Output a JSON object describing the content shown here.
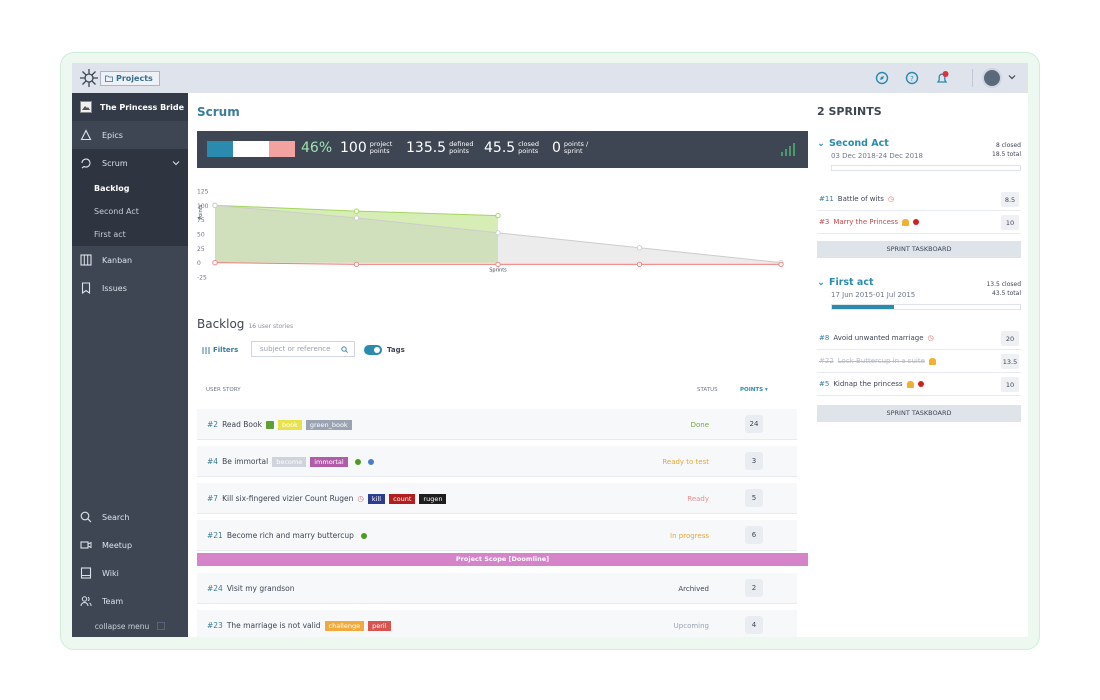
{
  "topbar": {
    "projects_label": "Projects"
  },
  "sidebar": {
    "project_name": "The Princess Bride",
    "items": [
      {
        "label": "Epics",
        "icon": "epics-icon"
      },
      {
        "label": "Scrum",
        "icon": "scrum-icon"
      },
      {
        "label": "Kanban",
        "icon": "kanban-icon"
      },
      {
        "label": "Issues",
        "icon": "issues-icon"
      }
    ],
    "scrum_sub": [
      "Backlog",
      "Second Act",
      "First act"
    ],
    "bottom": [
      {
        "label": "Search",
        "icon": "search-icon"
      },
      {
        "label": "Meetup",
        "icon": "meetup-icon"
      },
      {
        "label": "Wiki",
        "icon": "wiki-icon"
      },
      {
        "label": "Team",
        "icon": "team-icon"
      }
    ],
    "collapse_label": "collapse menu"
  },
  "main": {
    "title": "Scrum",
    "stats": {
      "percent": "46%",
      "closed_fraction": 0.3,
      "defined_fraction": 0.3,
      "project_points": "100",
      "project_points_label": "project points",
      "defined_points": "135.5",
      "defined_points_label": "defined points",
      "closed_points": "45.5",
      "closed_points_label": "closed points",
      "sprint_points": "0",
      "sprint_points_label": "points / sprint"
    },
    "backlog": {
      "title": "Backlog",
      "count": "16 user stories",
      "filters_label": "Filters",
      "search_placeholder": "subject or reference",
      "tags_label": "Tags",
      "col_story": "User story",
      "col_status": "Status",
      "col_points": "Points",
      "scope_label": "Project Scope [Doomline]"
    }
  },
  "chart_data": {
    "type": "area",
    "ylabel": "Points",
    "xlabel": "Sprints",
    "y_ticks": [
      "125",
      "100",
      "75",
      "50",
      "25",
      "0",
      "-25"
    ],
    "ylim": [
      -25,
      125
    ],
    "x": [
      0,
      1,
      2,
      3,
      4
    ],
    "series": [
      {
        "values": [
          100,
          90,
          82,
          null,
          null
        ],
        "color": "#a4d65e"
      },
      {
        "values": [
          100,
          78,
          52,
          26,
          0
        ],
        "color": "#cccccc"
      },
      {
        "values": [
          0,
          -3,
          -3,
          -3,
          -3
        ],
        "color": "#f08080"
      }
    ]
  },
  "stories": [
    {
      "ref": "#2",
      "title": "Read Book",
      "tags": [
        {
          "label": "book",
          "color": "#e9e34b"
        },
        {
          "label": "green_book",
          "color": "#9aa3b2"
        }
      ],
      "dots": [],
      "emoji": "book",
      "status": "Done",
      "status_color": "#7ba63a",
      "points": "24"
    },
    {
      "ref": "#4",
      "title": "Be immortal",
      "tags": [
        {
          "label": "become",
          "color": "#cfd3db"
        },
        {
          "label": "immortal",
          "color": "#b25ba8"
        }
      ],
      "dots": [
        "#4f9a23",
        "#4a7fc9"
      ],
      "status": "Ready to test",
      "status_color": "#e6a63c",
      "points": "3"
    },
    {
      "ref": "#7",
      "title": "Kill six-fingered vizier Count Rugen",
      "tags": [
        {
          "label": "kill",
          "color": "#2c3d8f"
        },
        {
          "label": "count",
          "color": "#b21d1d"
        },
        {
          "label": "rugen",
          "color": "#1e1e1e"
        }
      ],
      "dots": [],
      "clock": true,
      "status": "Ready",
      "status_color": "#e49090",
      "points": "5"
    },
    {
      "ref": "#21",
      "title": "Become rich and marry buttercup",
      "tags": [],
      "dots": [
        "#4f9a23"
      ],
      "status": "In progress",
      "status_color": "#e6a63c",
      "points": "6"
    },
    {
      "ref": "#24",
      "title": "Visit my grandson",
      "tags": [],
      "dots": [],
      "status": "Archived",
      "status_color": "#3e4654",
      "points": "2"
    },
    {
      "ref": "#23",
      "title": "The marriage is not valid",
      "tags": [
        {
          "label": "challenge",
          "color": "#f0a93a"
        },
        {
          "label": "peril",
          "color": "#d9534f"
        }
      ],
      "dots": [],
      "status": "Upcoming",
      "status_color": "#9aa3b2",
      "points": "4"
    }
  ],
  "right": {
    "title": "2 SPRINTS",
    "taskboard_label": "SPRINT TASKBOARD",
    "sprints": [
      {
        "name": "Second Act",
        "dates": "03 Dec 2018-24 Dec 2018",
        "closed": "8 closed",
        "total": "18.5 total",
        "progress": 0.0,
        "items": [
          {
            "ref": "#11",
            "title": "Battle of wits",
            "points": "8.5",
            "color": "#3e4654",
            "clock": true
          },
          {
            "ref": "#3",
            "title": "Marry the Princess",
            "points": "10",
            "color": "#c24a4a",
            "bell": true,
            "dot": "#d02020"
          }
        ]
      },
      {
        "name": "First act",
        "dates": "17 Jun 2015-01 Jul 2015",
        "closed": "13.5 closed",
        "total": "43.5 total",
        "progress": 0.33,
        "items": [
          {
            "ref": "#8",
            "title": "Avoid unwanted marriage",
            "points": "20",
            "color": "#3e4654",
            "clock": true
          },
          {
            "ref": "#22",
            "title": "Lock Buttercup in a suite",
            "points": "13.5",
            "color": "#b7bdc8",
            "strike": true,
            "bell": true
          },
          {
            "ref": "#5",
            "title": "Kidnap the princess",
            "points": "10",
            "color": "#3e4654",
            "bell": true,
            "dot": "#d02020"
          }
        ]
      }
    ]
  }
}
